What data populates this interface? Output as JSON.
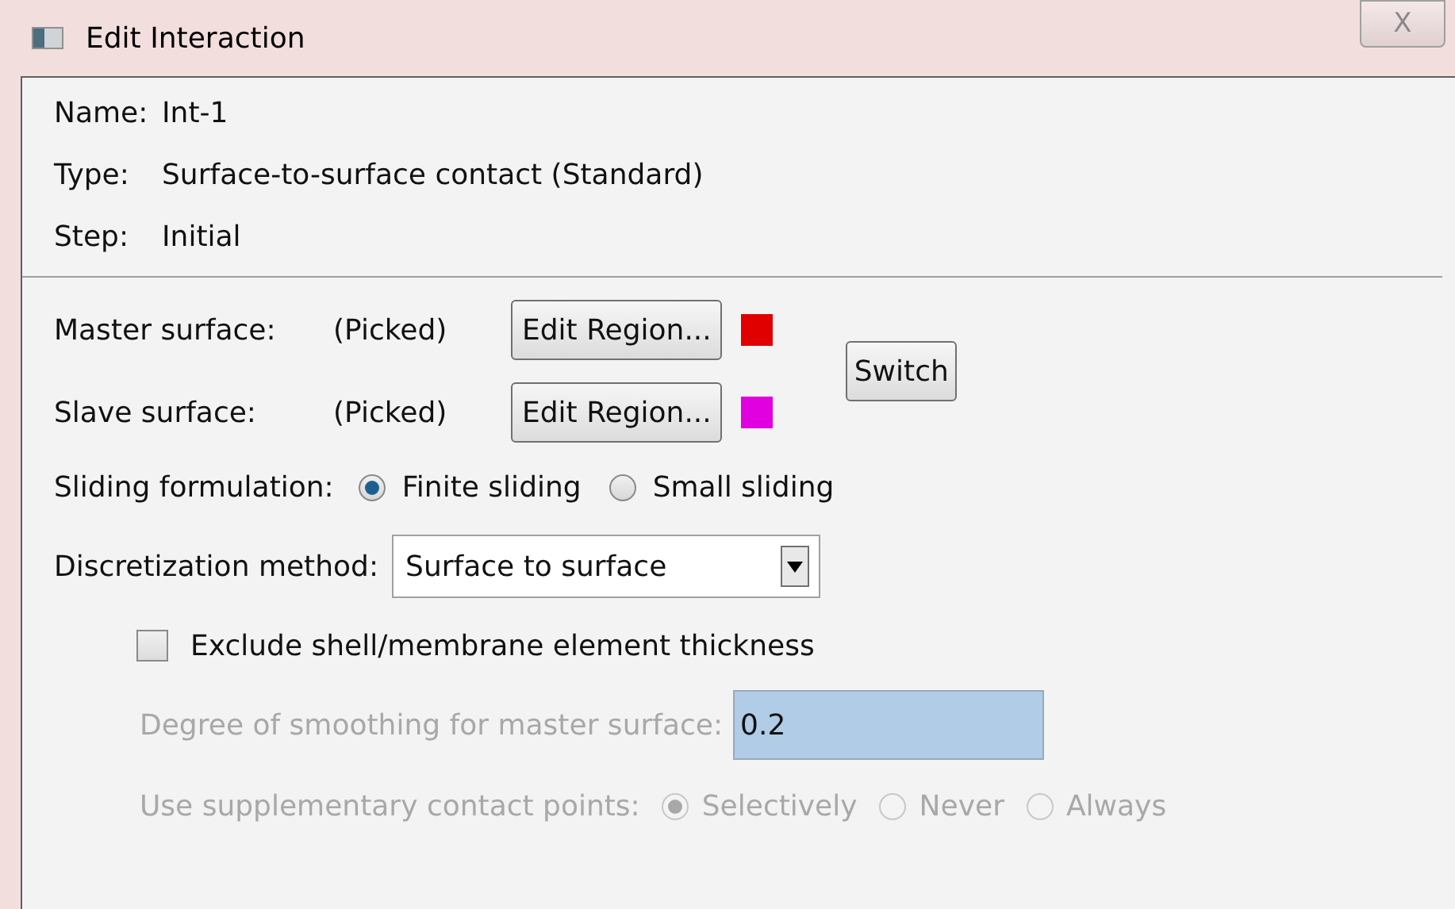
{
  "window": {
    "title": "Edit Interaction",
    "close": "X"
  },
  "info": [
    {
      "label": "Name:",
      "value": "Int-1"
    },
    {
      "label": "Type:",
      "value": "Surface-to-surface contact (Standard)"
    },
    {
      "label": "Step:",
      "value": "Initial"
    }
  ],
  "surfaces": [
    {
      "label": "Master surface:",
      "status": "(Picked)",
      "button": "Edit Region...",
      "color": "#e00000"
    },
    {
      "label": "Slave surface:",
      "status": "(Picked)",
      "button": "Edit Region...",
      "color": "#e000e0"
    }
  ],
  "switch_button": "Switch",
  "sliding": {
    "label": "Sliding formulation:",
    "options": [
      {
        "label": "Finite sliding",
        "selected": true
      },
      {
        "label": "Small sliding",
        "selected": false
      }
    ]
  },
  "discretization": {
    "label": "Discretization method:",
    "value": "Surface to surface"
  },
  "exclude": {
    "label": "Exclude shell/membrane element thickness",
    "checked": false
  },
  "smoothing": {
    "label": "Degree of smoothing for master surface:",
    "value": "0.2",
    "disabled": true
  },
  "supplementary": {
    "label": "Use supplementary contact points:",
    "disabled": true,
    "options": [
      {
        "label": "Selectively",
        "selected": true
      },
      {
        "label": "Never",
        "selected": false
      },
      {
        "label": "Always",
        "selected": false
      }
    ]
  }
}
